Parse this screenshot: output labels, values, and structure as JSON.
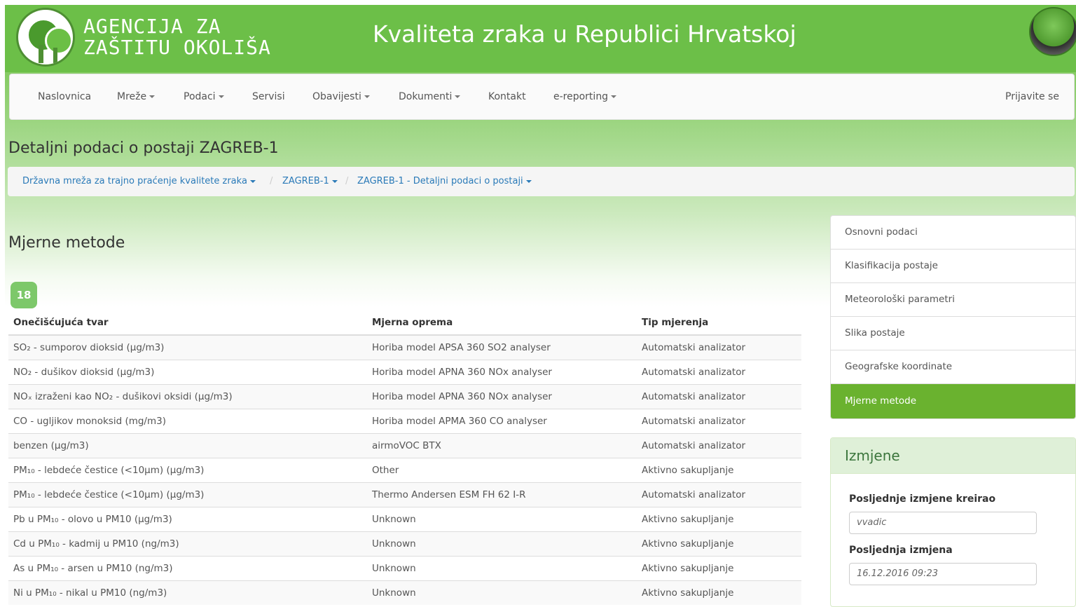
{
  "header": {
    "agency_line1": "AGENCIJA ZA",
    "agency_line2": "ZAŠTITU OKOLIŠA",
    "site_title": "Kvaliteta zraka u Republici Hrvatskoj"
  },
  "nav": {
    "items": [
      {
        "label": "Naslovnica",
        "dropdown": false
      },
      {
        "label": "Mreže",
        "dropdown": true
      },
      {
        "label": "Podaci",
        "dropdown": true
      },
      {
        "label": "Servisi",
        "dropdown": false
      },
      {
        "label": "Obavijesti",
        "dropdown": true
      },
      {
        "label": "Dokumenti",
        "dropdown": true
      },
      {
        "label": "Kontakt",
        "dropdown": false
      },
      {
        "label": "e-reporting",
        "dropdown": true
      }
    ],
    "login": "Prijavite se"
  },
  "page": {
    "title": "Detaljni podaci o postaji ZAGREB-1"
  },
  "breadcrumb": [
    "Državna mreža za trajno praćenje kvalitete zraka",
    "ZAGREB-1",
    "ZAGREB-1 - Detaljni podaci o postaji"
  ],
  "section": {
    "title": "Mjerne metode",
    "count": "18",
    "columns": [
      "Onečišćujuća tvar",
      "Mjerna oprema",
      "Tip mjerenja"
    ],
    "rows": [
      [
        "SO₂ - sumporov dioksid (μg/m3)",
        "Horiba model APSA 360 SO2 analyser",
        "Automatski analizator"
      ],
      [
        "NO₂ - dušikov dioksid (μg/m3)",
        "Horiba model APNA 360 NOx analyser",
        "Automatski analizator"
      ],
      [
        "NOₓ izraženi kao NO₂ - dušikovi oksidi (μg/m3)",
        "Horiba model APNA 360 NOx analyser",
        "Automatski analizator"
      ],
      [
        "CO - ugljikov monoksid (mg/m3)",
        "Horiba model APMA 360 CO analyser",
        "Automatski analizator"
      ],
      [
        "benzen (μg/m3)",
        "airmoVOC BTX",
        "Automatski analizator"
      ],
      [
        "PM₁₀ - lebdeće čestice (<10μm) (μg/m3)",
        "Other",
        "Aktivno sakupljanje"
      ],
      [
        "PM₁₀ - lebdeće čestice (<10μm) (μg/m3)",
        "Thermo Andersen ESM FH 62 I-R",
        "Automatski analizator"
      ],
      [
        "Pb u PM₁₀ - olovo u PM10 (μg/m3)",
        "Unknown",
        "Aktivno sakupljanje"
      ],
      [
        "Cd u PM₁₀ - kadmij u PM10 (ng/m3)",
        "Unknown",
        "Aktivno sakupljanje"
      ],
      [
        "As u PM₁₀ - arsen u PM10 (ng/m3)",
        "Unknown",
        "Aktivno sakupljanje"
      ],
      [
        "Ni u PM₁₀ - nikal u PM10 (ng/m3)",
        "Unknown",
        "Aktivno sakupljanje"
      ]
    ]
  },
  "sidebar": {
    "items": [
      "Osnovni podaci",
      "Klasifikacija postaje",
      "Meteorološki parametri",
      "Slika postaje",
      "Geografske koordinate",
      "Mjerne metode"
    ],
    "active_label": "Mjerne metode"
  },
  "changes": {
    "title": "Izmjene",
    "created_by_label": "Posljednje izmjene kreirao",
    "created_by_value": "vvadic",
    "last_change_label": "Posljednja izmjena",
    "last_change_value": "16.12.2016 09:23"
  },
  "colors": {
    "header_green": "#6cbf48",
    "active_green": "#6ab22f",
    "badge_green": "#7dc86a",
    "link_blue": "#2a7ab8"
  }
}
